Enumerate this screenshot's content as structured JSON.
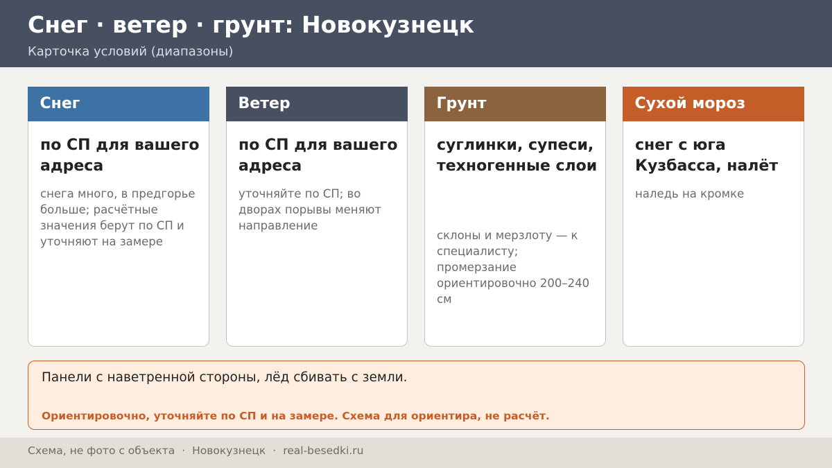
{
  "header": {
    "title": "Снег · ветер · грунт: Новокузнецк",
    "subtitle": "Карточка условий (диапазоны)"
  },
  "cards": [
    {
      "label": "Снег",
      "color": "#3d72a7",
      "main": "по СП для вашего адреса",
      "note": "снега много, в предгорье больше; расчётные значения берут по СП и уточняют на замере"
    },
    {
      "label": "Ветер",
      "color": "#475060",
      "main": "по СП для вашего адреса",
      "note": "уточняйте по СП; во дворах порывы меняют направление"
    },
    {
      "label": "Грунт",
      "color": "#8b633f",
      "main": "суглинки, супеси, техногенные слои",
      "note": "склоны и мерзлоту — к специалисту; промерзание ориентировочно 200–240 см"
    },
    {
      "label": "Сухой мороз",
      "color": "#c45d28",
      "main": "снег с юга Кузбасса, налёт",
      "note": "наледь на кромке"
    }
  ],
  "note_box": {
    "main": "Панели с наветренной стороны, лёд сбивать с земли.",
    "warning": "Ориентировочно, уточняйте по СП и на замере. Схема для ориентира, не расчёт."
  },
  "footer": {
    "item1": "Схема, не фото с объекта",
    "item2": "Новокузнецк",
    "item3": "real-besedki.ru",
    "separator": "·"
  }
}
